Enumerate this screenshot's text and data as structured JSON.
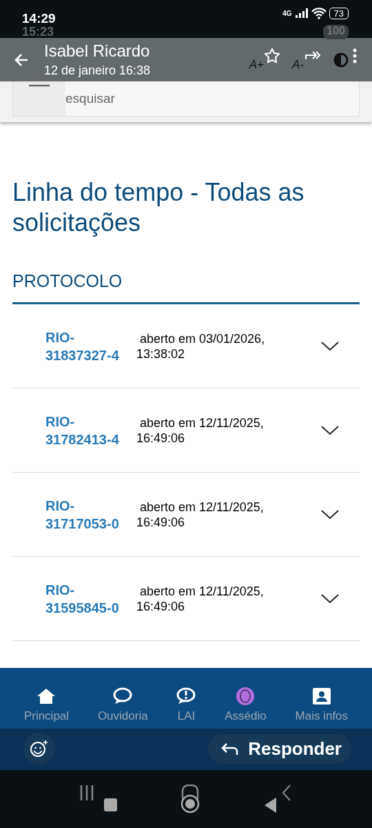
{
  "status_bar": {
    "time": "14:29",
    "network": "4G",
    "battery": "73",
    "background_time": "15:23",
    "background_battery": "100"
  },
  "viewer_header": {
    "sender": "Isabel Ricardo",
    "date": "12 de janeiro 16:38",
    "font_increase": "A+",
    "font_decrease": "A-"
  },
  "search": {
    "placeholder": "esquisar"
  },
  "page": {
    "title": "Linha do tempo - Todas as solicitações",
    "section": "PROTOCOLO"
  },
  "protocols": [
    {
      "number": "RIO-31837327-4",
      "opened": "aberto em 03/01/2026, 13:38:02"
    },
    {
      "number": "RIO-31782413-4",
      "opened": "aberto em 12/11/2025, 16:49:06"
    },
    {
      "number": "RIO-31717053-0",
      "opened": "aberto em 12/11/2025, 16:49:06"
    },
    {
      "number": "RIO-31595845-0",
      "opened": "aberto em 12/11/2025, 16:49:06"
    }
  ],
  "bottom_nav": [
    {
      "label": "Principal",
      "kind": "home"
    },
    {
      "label": "Ouvidoria",
      "kind": "chat"
    },
    {
      "label": "LAI",
      "kind": "alert"
    },
    {
      "label": "Assédio",
      "kind": "avatar"
    },
    {
      "label": "Mais infos",
      "kind": "contact"
    }
  ],
  "reply": {
    "label": "Responder"
  }
}
